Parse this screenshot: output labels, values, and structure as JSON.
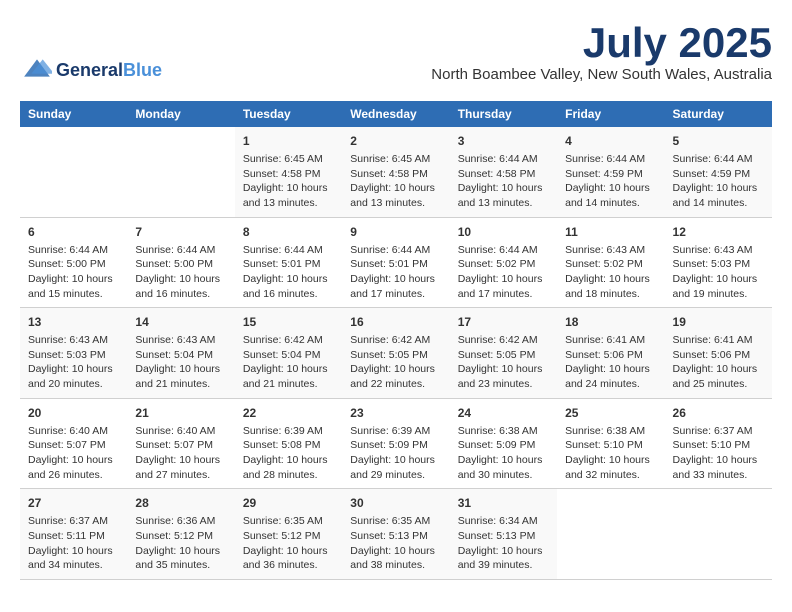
{
  "header": {
    "logo_line1": "General",
    "logo_line2": "Blue",
    "month_year": "July 2025",
    "location": "North Boambee Valley, New South Wales, Australia"
  },
  "weekdays": [
    "Sunday",
    "Monday",
    "Tuesday",
    "Wednesday",
    "Thursday",
    "Friday",
    "Saturday"
  ],
  "weeks": [
    [
      {
        "day": "",
        "sunrise": "",
        "sunset": "",
        "daylight": ""
      },
      {
        "day": "",
        "sunrise": "",
        "sunset": "",
        "daylight": ""
      },
      {
        "day": "1",
        "sunrise": "Sunrise: 6:45 AM",
        "sunset": "Sunset: 4:58 PM",
        "daylight": "Daylight: 10 hours and 13 minutes."
      },
      {
        "day": "2",
        "sunrise": "Sunrise: 6:45 AM",
        "sunset": "Sunset: 4:58 PM",
        "daylight": "Daylight: 10 hours and 13 minutes."
      },
      {
        "day": "3",
        "sunrise": "Sunrise: 6:44 AM",
        "sunset": "Sunset: 4:58 PM",
        "daylight": "Daylight: 10 hours and 13 minutes."
      },
      {
        "day": "4",
        "sunrise": "Sunrise: 6:44 AM",
        "sunset": "Sunset: 4:59 PM",
        "daylight": "Daylight: 10 hours and 14 minutes."
      },
      {
        "day": "5",
        "sunrise": "Sunrise: 6:44 AM",
        "sunset": "Sunset: 4:59 PM",
        "daylight": "Daylight: 10 hours and 14 minutes."
      }
    ],
    [
      {
        "day": "6",
        "sunrise": "Sunrise: 6:44 AM",
        "sunset": "Sunset: 5:00 PM",
        "daylight": "Daylight: 10 hours and 15 minutes."
      },
      {
        "day": "7",
        "sunrise": "Sunrise: 6:44 AM",
        "sunset": "Sunset: 5:00 PM",
        "daylight": "Daylight: 10 hours and 16 minutes."
      },
      {
        "day": "8",
        "sunrise": "Sunrise: 6:44 AM",
        "sunset": "Sunset: 5:01 PM",
        "daylight": "Daylight: 10 hours and 16 minutes."
      },
      {
        "day": "9",
        "sunrise": "Sunrise: 6:44 AM",
        "sunset": "Sunset: 5:01 PM",
        "daylight": "Daylight: 10 hours and 17 minutes."
      },
      {
        "day": "10",
        "sunrise": "Sunrise: 6:44 AM",
        "sunset": "Sunset: 5:02 PM",
        "daylight": "Daylight: 10 hours and 17 minutes."
      },
      {
        "day": "11",
        "sunrise": "Sunrise: 6:43 AM",
        "sunset": "Sunset: 5:02 PM",
        "daylight": "Daylight: 10 hours and 18 minutes."
      },
      {
        "day": "12",
        "sunrise": "Sunrise: 6:43 AM",
        "sunset": "Sunset: 5:03 PM",
        "daylight": "Daylight: 10 hours and 19 minutes."
      }
    ],
    [
      {
        "day": "13",
        "sunrise": "Sunrise: 6:43 AM",
        "sunset": "Sunset: 5:03 PM",
        "daylight": "Daylight: 10 hours and 20 minutes."
      },
      {
        "day": "14",
        "sunrise": "Sunrise: 6:43 AM",
        "sunset": "Sunset: 5:04 PM",
        "daylight": "Daylight: 10 hours and 21 minutes."
      },
      {
        "day": "15",
        "sunrise": "Sunrise: 6:42 AM",
        "sunset": "Sunset: 5:04 PM",
        "daylight": "Daylight: 10 hours and 21 minutes."
      },
      {
        "day": "16",
        "sunrise": "Sunrise: 6:42 AM",
        "sunset": "Sunset: 5:05 PM",
        "daylight": "Daylight: 10 hours and 22 minutes."
      },
      {
        "day": "17",
        "sunrise": "Sunrise: 6:42 AM",
        "sunset": "Sunset: 5:05 PM",
        "daylight": "Daylight: 10 hours and 23 minutes."
      },
      {
        "day": "18",
        "sunrise": "Sunrise: 6:41 AM",
        "sunset": "Sunset: 5:06 PM",
        "daylight": "Daylight: 10 hours and 24 minutes."
      },
      {
        "day": "19",
        "sunrise": "Sunrise: 6:41 AM",
        "sunset": "Sunset: 5:06 PM",
        "daylight": "Daylight: 10 hours and 25 minutes."
      }
    ],
    [
      {
        "day": "20",
        "sunrise": "Sunrise: 6:40 AM",
        "sunset": "Sunset: 5:07 PM",
        "daylight": "Daylight: 10 hours and 26 minutes."
      },
      {
        "day": "21",
        "sunrise": "Sunrise: 6:40 AM",
        "sunset": "Sunset: 5:07 PM",
        "daylight": "Daylight: 10 hours and 27 minutes."
      },
      {
        "day": "22",
        "sunrise": "Sunrise: 6:39 AM",
        "sunset": "Sunset: 5:08 PM",
        "daylight": "Daylight: 10 hours and 28 minutes."
      },
      {
        "day": "23",
        "sunrise": "Sunrise: 6:39 AM",
        "sunset": "Sunset: 5:09 PM",
        "daylight": "Daylight: 10 hours and 29 minutes."
      },
      {
        "day": "24",
        "sunrise": "Sunrise: 6:38 AM",
        "sunset": "Sunset: 5:09 PM",
        "daylight": "Daylight: 10 hours and 30 minutes."
      },
      {
        "day": "25",
        "sunrise": "Sunrise: 6:38 AM",
        "sunset": "Sunset: 5:10 PM",
        "daylight": "Daylight: 10 hours and 32 minutes."
      },
      {
        "day": "26",
        "sunrise": "Sunrise: 6:37 AM",
        "sunset": "Sunset: 5:10 PM",
        "daylight": "Daylight: 10 hours and 33 minutes."
      }
    ],
    [
      {
        "day": "27",
        "sunrise": "Sunrise: 6:37 AM",
        "sunset": "Sunset: 5:11 PM",
        "daylight": "Daylight: 10 hours and 34 minutes."
      },
      {
        "day": "28",
        "sunrise": "Sunrise: 6:36 AM",
        "sunset": "Sunset: 5:12 PM",
        "daylight": "Daylight: 10 hours and 35 minutes."
      },
      {
        "day": "29",
        "sunrise": "Sunrise: 6:35 AM",
        "sunset": "Sunset: 5:12 PM",
        "daylight": "Daylight: 10 hours and 36 minutes."
      },
      {
        "day": "30",
        "sunrise": "Sunrise: 6:35 AM",
        "sunset": "Sunset: 5:13 PM",
        "daylight": "Daylight: 10 hours and 38 minutes."
      },
      {
        "day": "31",
        "sunrise": "Sunrise: 6:34 AM",
        "sunset": "Sunset: 5:13 PM",
        "daylight": "Daylight: 10 hours and 39 minutes."
      },
      {
        "day": "",
        "sunrise": "",
        "sunset": "",
        "daylight": ""
      },
      {
        "day": "",
        "sunrise": "",
        "sunset": "",
        "daylight": ""
      }
    ]
  ]
}
